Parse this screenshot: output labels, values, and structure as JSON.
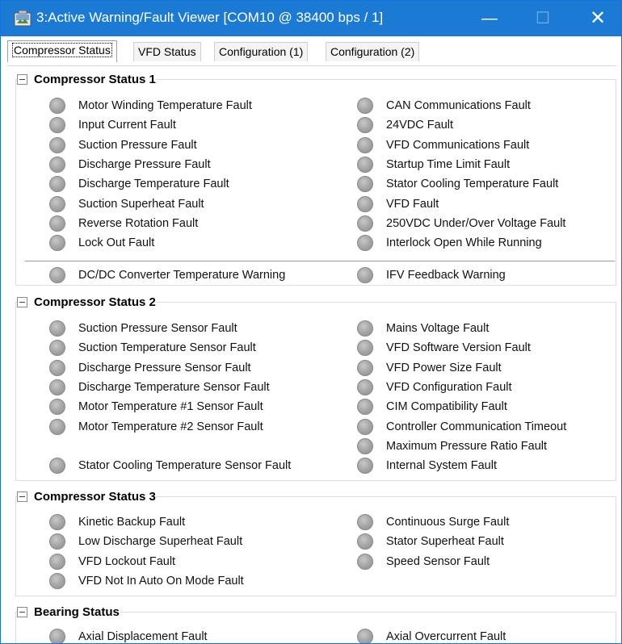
{
  "window": {
    "title": "3:Active Warning/Fault Viewer [COM10 @ 38400 bps / 1]",
    "icon": "cold-storage-app-icon",
    "minimize_glyph": "—",
    "maximize_glyph": "☐",
    "close_glyph": "✕",
    "accent_color": "#1a7ad4"
  },
  "tabs": [
    {
      "label": "Compressor Status",
      "active": true
    },
    {
      "label": "VFD Status",
      "active": false
    },
    {
      "label": "Configuration (1)",
      "active": false
    },
    {
      "label": "Configuration (2)",
      "active": false
    }
  ],
  "groups": {
    "cs1": {
      "title": "Compressor Status 1",
      "left": [
        "Motor Winding Temperature Fault",
        "Input Current Fault",
        "Suction Pressure Fault",
        "Discharge Pressure Fault",
        "Discharge Temperature Fault",
        "Suction Superheat Fault",
        "Reverse Rotation Fault",
        "Lock Out Fault"
      ],
      "right": [
        "CAN Communications Fault",
        "24VDC Fault",
        "VFD Communications Fault",
        "Startup Time Limit Fault",
        "Stator Cooling Temperature Fault",
        "VFD Fault",
        "250VDC Under/Over Voltage Fault",
        "Interlock Open While Running"
      ],
      "warnings_left": "DC/DC Converter Temperature Warning",
      "warnings_right": "IFV Feedback Warning"
    },
    "cs2": {
      "title": "Compressor Status 2",
      "left": [
        "Suction Pressure Sensor Fault",
        "Suction Temperature Sensor Fault",
        "Discharge Pressure Sensor Fault",
        "Discharge Temperature Sensor Fault",
        "Motor Temperature #1 Sensor Fault",
        "Motor Temperature #2 Sensor Fault",
        "",
        "Stator Cooling Temperature Sensor Fault"
      ],
      "right": [
        "Mains Voltage Fault",
        "VFD Software Version Fault",
        "VFD Power Size Fault",
        "VFD Configuration Fault",
        "CIM Compatibility Fault",
        "Controller Communication Timeout",
        "Maximum Pressure Ratio Fault",
        "Internal System Fault"
      ]
    },
    "cs3": {
      "title": "Compressor Status 3",
      "left": [
        "Kinetic Backup Fault",
        "Low Discharge Superheat Fault",
        "VFD Lockout Fault",
        "VFD Not In Auto On Mode Fault"
      ],
      "right": [
        "Continuous Surge Fault",
        "Stator Superheat Fault",
        "Speed Sensor Fault"
      ]
    },
    "bearing": {
      "title": "Bearing Status",
      "left": [
        "Axial Displacement Fault"
      ],
      "right": [
        "Axial Overcurrent Fault"
      ]
    }
  },
  "led_color_off": "#a9a9a9"
}
